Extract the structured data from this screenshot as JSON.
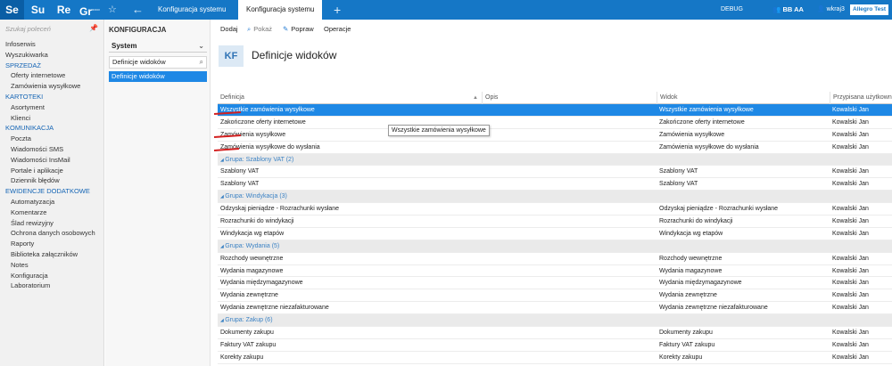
{
  "topbar": {
    "apps": [
      "Se",
      "Su",
      "Re",
      "Gr"
    ],
    "app_superscript": "RODO",
    "star_icon": "star-icon",
    "back_icon": "arrow-left-icon",
    "tabs": [
      "Konfiguracja systemu",
      "Konfiguracja systemu"
    ],
    "add_icon": "plus-icon",
    "debug": "DEBUG",
    "user_initials": "BB AA",
    "user_name": "wkraj3",
    "allegro_label": "Allegro Test",
    "color": "#1577c6"
  },
  "sidebar": {
    "search_placeholder": "Szukaj poleceń",
    "pin_icon": "pin-icon",
    "items": [
      {
        "type": "item",
        "label": "Infoserwis"
      },
      {
        "type": "item",
        "label": "Wyszukiwarka"
      },
      {
        "type": "section",
        "label": "SPRZEDAŻ"
      },
      {
        "type": "sub",
        "label": "Oferty internetowe"
      },
      {
        "type": "sub",
        "label": "Zamówienia wysyłkowe"
      },
      {
        "type": "section",
        "label": "KARTOTEKI"
      },
      {
        "type": "sub",
        "label": "Asortyment"
      },
      {
        "type": "sub",
        "label": "Klienci"
      },
      {
        "type": "section",
        "label": "KOMUNIKACJA"
      },
      {
        "type": "sub",
        "label": "Poczta"
      },
      {
        "type": "sub",
        "label": "Wiadomości SMS"
      },
      {
        "type": "sub",
        "label": "Wiadomości InsMail"
      },
      {
        "type": "sub",
        "label": "Portale i aplikacje"
      },
      {
        "type": "sub",
        "label": "Dziennik błędów"
      },
      {
        "type": "section",
        "label": "EWIDENCJE DODATKOWE"
      },
      {
        "type": "sub",
        "label": "Automatyzacja"
      },
      {
        "type": "sub",
        "label": "Komentarze"
      },
      {
        "type": "sub",
        "label": "Ślad rewizyjny"
      },
      {
        "type": "sub",
        "label": "Ochrona danych osobowych"
      },
      {
        "type": "sub",
        "label": "Raporty"
      },
      {
        "type": "sub",
        "label": "Biblioteka załączników"
      },
      {
        "type": "sub",
        "label": "Notes"
      },
      {
        "type": "sub",
        "label": "Konfiguracja"
      },
      {
        "type": "sub",
        "label": "Laboratorium"
      }
    ]
  },
  "panel2": {
    "title": "KONFIGURACJA",
    "select_value": "System",
    "filter_value": "Definicje widoków",
    "selected_item": "Definicje widoków"
  },
  "toolbar": {
    "add": "Dodaj",
    "show": "Pokaż",
    "edit": "Popraw",
    "operations": "Operacje"
  },
  "page": {
    "badge": "KF",
    "title": "Definicje widoków"
  },
  "grid": {
    "columns": [
      "Definicja",
      "Opis",
      "Widok",
      "Przypisana użytkown"
    ],
    "rows": [
      {
        "type": "sel",
        "def": "Wszystkie zamówienia wysyłkowe",
        "opis": "",
        "widok": "Wszystkie zamówienia wysyłkowe",
        "user": "Kowalski Jan"
      },
      {
        "type": "row",
        "def": "Zakończone oferty internetowe",
        "opis": "",
        "widok": "Zakończone oferty internetowe",
        "user": "Kowalski Jan"
      },
      {
        "type": "row",
        "def": "Zamówienia wysyłkowe",
        "opis": "",
        "widok": "Zamówienia wysyłkowe",
        "user": "Kowalski Jan"
      },
      {
        "type": "row",
        "def": "Zamówienia wysyłkowe do wysłania",
        "opis": "",
        "widok": "Zamówienia wysyłkowe do wysłania",
        "user": "Kowalski Jan"
      },
      {
        "type": "group",
        "label": "Grupa: Szablony VAT (2)"
      },
      {
        "type": "row",
        "def": "Szablony VAT",
        "opis": "",
        "widok": "Szablony VAT",
        "user": "Kowalski Jan"
      },
      {
        "type": "row",
        "def": "Szablony VAT",
        "opis": "",
        "widok": "Szablony VAT",
        "user": "Kowalski Jan"
      },
      {
        "type": "group",
        "label": "Grupa: Windykacja (3)"
      },
      {
        "type": "row",
        "def": "Odzyskaj pieniądze - Rozrachunki wysłane",
        "opis": "",
        "widok": "Odzyskaj pieniądze - Rozrachunki wysłane",
        "user": "Kowalski Jan"
      },
      {
        "type": "row",
        "def": "Rozrachunki do windykacji",
        "opis": "",
        "widok": "Rozrachunki do windykacji",
        "user": "Kowalski Jan"
      },
      {
        "type": "row",
        "def": "Windykacja wg etapów",
        "opis": "",
        "widok": "Windykacja wg etapów",
        "user": "Kowalski Jan"
      },
      {
        "type": "group",
        "label": "Grupa: Wydania (5)"
      },
      {
        "type": "row",
        "def": "Rozchody wewnętrzne",
        "opis": "",
        "widok": "Rozchody wewnętrzne",
        "user": "Kowalski Jan"
      },
      {
        "type": "row",
        "def": "Wydania magazynowe",
        "opis": "",
        "widok": "Wydania magazynowe",
        "user": "Kowalski Jan"
      },
      {
        "type": "row",
        "def": "Wydania międzymagazynowe",
        "opis": "",
        "widok": "Wydania międzymagazynowe",
        "user": "Kowalski Jan"
      },
      {
        "type": "row",
        "def": "Wydania zewnętrzne",
        "opis": "",
        "widok": "Wydania zewnętrzne",
        "user": "Kowalski Jan"
      },
      {
        "type": "row",
        "def": "Wydania zewnętrzne niezafakturowane",
        "opis": "",
        "widok": "Wydania zewnętrzne niezafakturowane",
        "user": "Kowalski Jan"
      },
      {
        "type": "group",
        "label": "Grupa: Zakup (6)"
      },
      {
        "type": "row",
        "def": "Dokumenty zakupu",
        "opis": "",
        "widok": "Dokumenty zakupu",
        "user": "Kowalski Jan"
      },
      {
        "type": "row",
        "def": "Faktury VAT zakupu",
        "opis": "",
        "widok": "Faktury VAT zakupu",
        "user": "Kowalski Jan"
      },
      {
        "type": "row",
        "def": "Korekty zakupu",
        "opis": "",
        "widok": "Korekty zakupu",
        "user": "Kowalski Jan"
      }
    ],
    "tooltip": "Wszystkie zamówienia wysyłkowe"
  }
}
